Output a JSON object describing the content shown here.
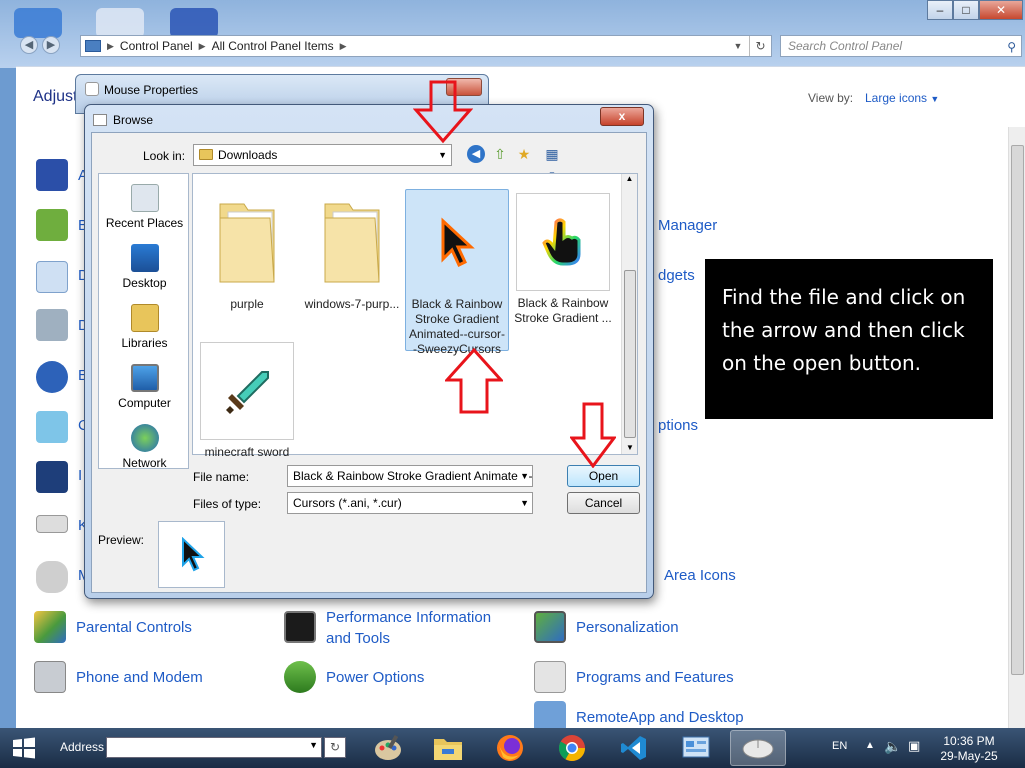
{
  "control_panel": {
    "breadcrumb": [
      "Control Panel",
      "All Control Panel Items"
    ],
    "search_placeholder": "Search Control Panel",
    "title_partial": "Adjust y",
    "view_by_label": "View by:",
    "view_by_value": "Large icons",
    "items": [
      {
        "label": "Parental Controls"
      },
      {
        "label": "Performance Information and Tools"
      },
      {
        "label": "Personalization"
      },
      {
        "label": "Phone and Modem"
      },
      {
        "label": "Power Options"
      },
      {
        "label": "Programs and Features"
      },
      {
        "label": "RemoteApp and Desktop"
      }
    ],
    "partial_items": {
      "manager": "Manager",
      "gadgets": "dgets",
      "options": "ptions",
      "area_icons": "Area Icons",
      "letters": [
        "A",
        "B",
        "D",
        "D",
        "E",
        "C",
        "I",
        "K",
        "M"
      ]
    }
  },
  "mouse_properties": {
    "title": "Mouse Properties"
  },
  "browse": {
    "title": "Browse",
    "look_in_label": "Look in:",
    "look_in_value": "Downloads",
    "places": [
      "Recent Places",
      "Desktop",
      "Libraries",
      "Computer",
      "Network"
    ],
    "files": [
      {
        "name": "purple"
      },
      {
        "name": "windows-7-purp..."
      },
      {
        "name": "Black & Rainbow Stroke Gradient Animated--cursor--SweezyCursors"
      },
      {
        "name": "Black & Rainbow Stroke Gradient ..."
      },
      {
        "name": "minecraft sword"
      }
    ],
    "file_name_label": "File name:",
    "file_name_value": "Black & Rainbow Stroke Gradient Animated--cursor--SweezyCursors",
    "files_of_type_label": "Files of type:",
    "files_of_type_value": "Cursors (*.ani, *.cur)",
    "open_label": "Open",
    "cancel_label": "Cancel",
    "preview_label": "Preview:",
    "close_label": "x"
  },
  "annotation": {
    "text": "Find the file and click on the arrow and then click on the open button."
  },
  "taskbar": {
    "address_label": "Address",
    "language": "EN",
    "time": "10:36 PM",
    "date": "29-May-25"
  },
  "colors": {
    "link": "#1e5bc6",
    "arrow": "#e8141b",
    "note_bg": "#000000"
  }
}
